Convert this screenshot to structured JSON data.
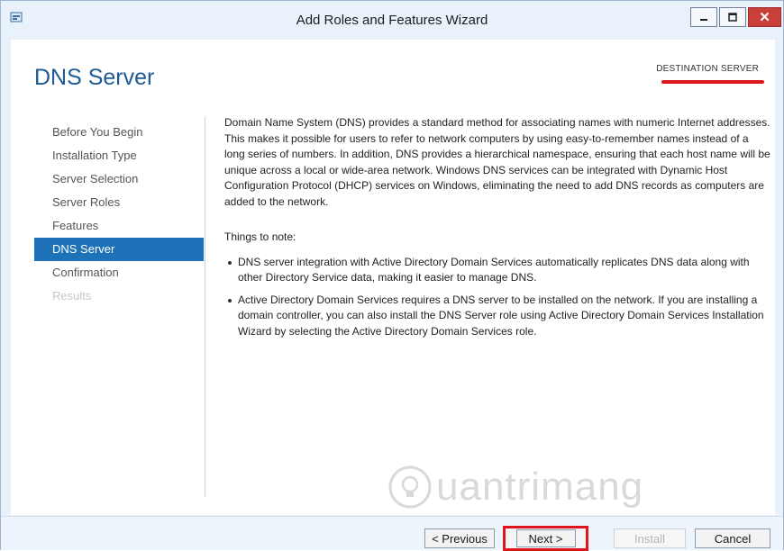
{
  "window": {
    "title": "Add Roles and Features Wizard"
  },
  "header": {
    "page_title": "DNS Server",
    "destination_label": "DESTINATION SERVER"
  },
  "nav": {
    "items": [
      {
        "label": "Before You Begin",
        "state": "normal"
      },
      {
        "label": "Installation Type",
        "state": "normal"
      },
      {
        "label": "Server Selection",
        "state": "normal"
      },
      {
        "label": "Server Roles",
        "state": "normal"
      },
      {
        "label": "Features",
        "state": "normal"
      },
      {
        "label": "DNS Server",
        "state": "active"
      },
      {
        "label": "Confirmation",
        "state": "normal"
      },
      {
        "label": "Results",
        "state": "disabled"
      }
    ]
  },
  "main": {
    "intro": "Domain Name System (DNS) provides a standard method for associating names with numeric Internet addresses. This makes it possible for users to refer to network computers by using easy-to-remember names instead of a long series of numbers. In addition, DNS provides a hierarchical namespace, ensuring that each host name will be unique across a local or wide-area network. Windows DNS services can be integrated with Dynamic Host Configuration Protocol (DHCP) services on Windows, eliminating the need to add DNS records as computers are added to the network.",
    "notes_title": "Things to note:",
    "bullets": [
      "DNS server integration with Active Directory Domain Services automatically replicates DNS data along with other Directory Service data, making it easier to manage DNS.",
      "Active Directory Domain Services requires a DNS server to be installed on the network. If you are installing a domain controller, you can also install the DNS Server role using Active Directory Domain Services Installation Wizard by selecting the Active Directory Domain Services role."
    ]
  },
  "watermark": {
    "text": "uantrimang"
  },
  "footer": {
    "previous_label": "< Previous",
    "next_label": "Next >",
    "install_label": "Install",
    "cancel_label": "Cancel"
  },
  "colors": {
    "accent": "#1e72b8",
    "title_blue": "#1e5a96",
    "highlight_red": "#e0141c"
  }
}
